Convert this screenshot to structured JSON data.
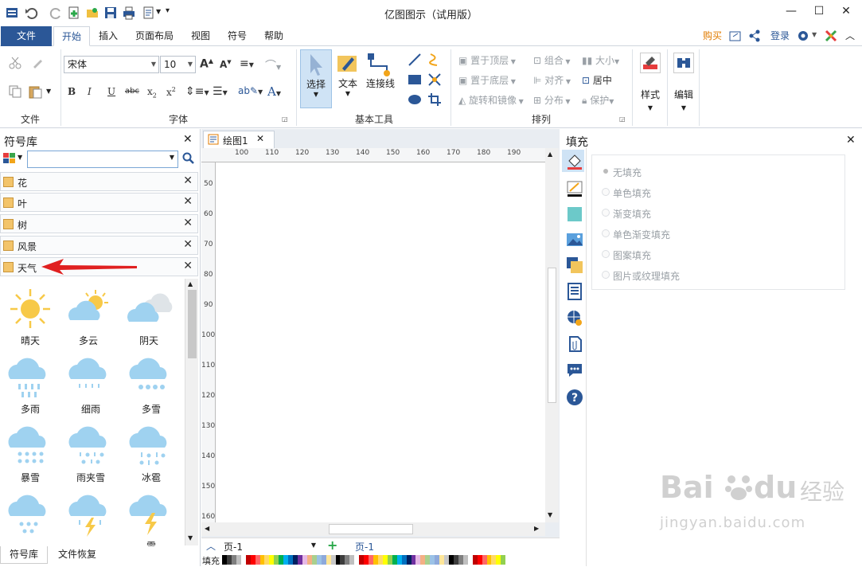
{
  "window": {
    "title": "亿图图示（试用版）",
    "minimize": "—",
    "maximize": "☐",
    "close": "✕"
  },
  "tabs": {
    "file": "文件",
    "home": "开始",
    "insert": "插入",
    "page_layout": "页面布局",
    "view": "视图",
    "symbol": "符号",
    "help": "帮助",
    "buy": "购买",
    "login": "登录"
  },
  "ribbon": {
    "groups": {
      "file": "文件",
      "font": "字体",
      "basic_tools": "基本工具",
      "arrange": "排列"
    },
    "font_name": "宋体",
    "font_size": "10",
    "tools": {
      "select": "选择",
      "text": "文本",
      "connector": "连接线"
    },
    "arrange": {
      "bring_front": "置于顶层",
      "send_back": "置于底层",
      "rotate_mirror": "旋转和镜像",
      "group": "组合",
      "align": "对齐",
      "distribute": "分布",
      "size": "大小",
      "center": "居中",
      "protect": "保护"
    },
    "style": "样式",
    "edit": "编辑"
  },
  "library": {
    "title": "符号库",
    "close": "✕",
    "categories": [
      "花",
      "叶",
      "树",
      "风景",
      "天气"
    ],
    "symbols": [
      "晴天",
      "多云",
      "阴天",
      "多雨",
      "细雨",
      "多雪",
      "暴雪",
      "雨夹雪",
      "冰雹",
      "",
      "",
      "雷"
    ],
    "bottom_tabs": [
      "符号库",
      "文件恢复"
    ]
  },
  "document": {
    "tab": "绘图1",
    "ruler_h": [
      "100",
      "110",
      "120",
      "130",
      "140",
      "150",
      "160",
      "170",
      "180",
      "190"
    ],
    "ruler_v": [
      "50",
      "60",
      "70",
      "80",
      "90",
      "100",
      "110",
      "120",
      "130",
      "140",
      "150",
      "160"
    ],
    "page": "页-1",
    "page_tab": "页-1",
    "fill_label": "填充"
  },
  "fill_panel": {
    "title": "填充",
    "options": [
      "无填充",
      "单色填充",
      "渐变填充",
      "单色渐变填充",
      "图案填充",
      "图片或纹理填充"
    ]
  },
  "watermark": {
    "brand": "Bai",
    "brand2": "du",
    "jy": "经验",
    "url": "jingyan.baidu.com"
  },
  "colors": {
    "accent": "#2b5797",
    "buy": "#e07b00",
    "arrow": "#e02020",
    "weather_blue": "#9fd2f0",
    "sun": "#f7c948"
  }
}
